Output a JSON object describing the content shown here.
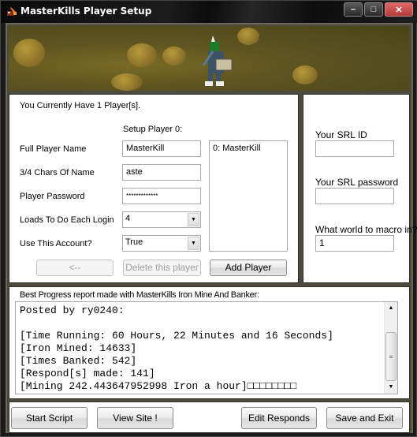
{
  "window": {
    "title": "MasterKills Player Setup",
    "icon": "pickaxe-app-icon",
    "controls": {
      "minimize": "–",
      "maximize": "□",
      "close": "✕"
    }
  },
  "setup": {
    "player_count_text": "You Currently Have 1 Player[s].",
    "setup_heading": "Setup Player 0:",
    "fields": {
      "full_name": {
        "label": "Full Player Name",
        "value": "MasterKill"
      },
      "short_name": {
        "label": "3/4 Chars Of Name",
        "value": "aste"
      },
      "password": {
        "label": "Player Password",
        "value": "*************"
      },
      "loads": {
        "label": "Loads To Do Each Login",
        "value": "4"
      },
      "use_account": {
        "label": "Use This Account?",
        "value": "True"
      }
    },
    "player_list": [
      "0: MasterKill"
    ],
    "buttons": {
      "back": "<--",
      "delete": "Delete this player",
      "add": "Add Player"
    }
  },
  "srl": {
    "id_label": "Your SRL ID",
    "id_value": "",
    "password_label": "Your SRL password",
    "password_value": "",
    "world_label": "What world to macro in?",
    "world_value": "1"
  },
  "report": {
    "heading": "Best Progress report made with MasterKills Iron Mine And Banker:",
    "lines": [
      "Posted by ry0240:",
      "",
      "[Time Running: 60 Hours, 22 Minutes and 16 Seconds]",
      "[Iron Mined: 14633]",
      "[Times Banked: 542]",
      "[Respond[s] made: 141]",
      "[Mining 242.443647952998 Iron a hour]□□□□□□□□"
    ]
  },
  "footer": {
    "start": "Start Script",
    "view_site": "View Site !",
    "edit_responds": "Edit Responds",
    "save_exit": "Save and Exit"
  }
}
